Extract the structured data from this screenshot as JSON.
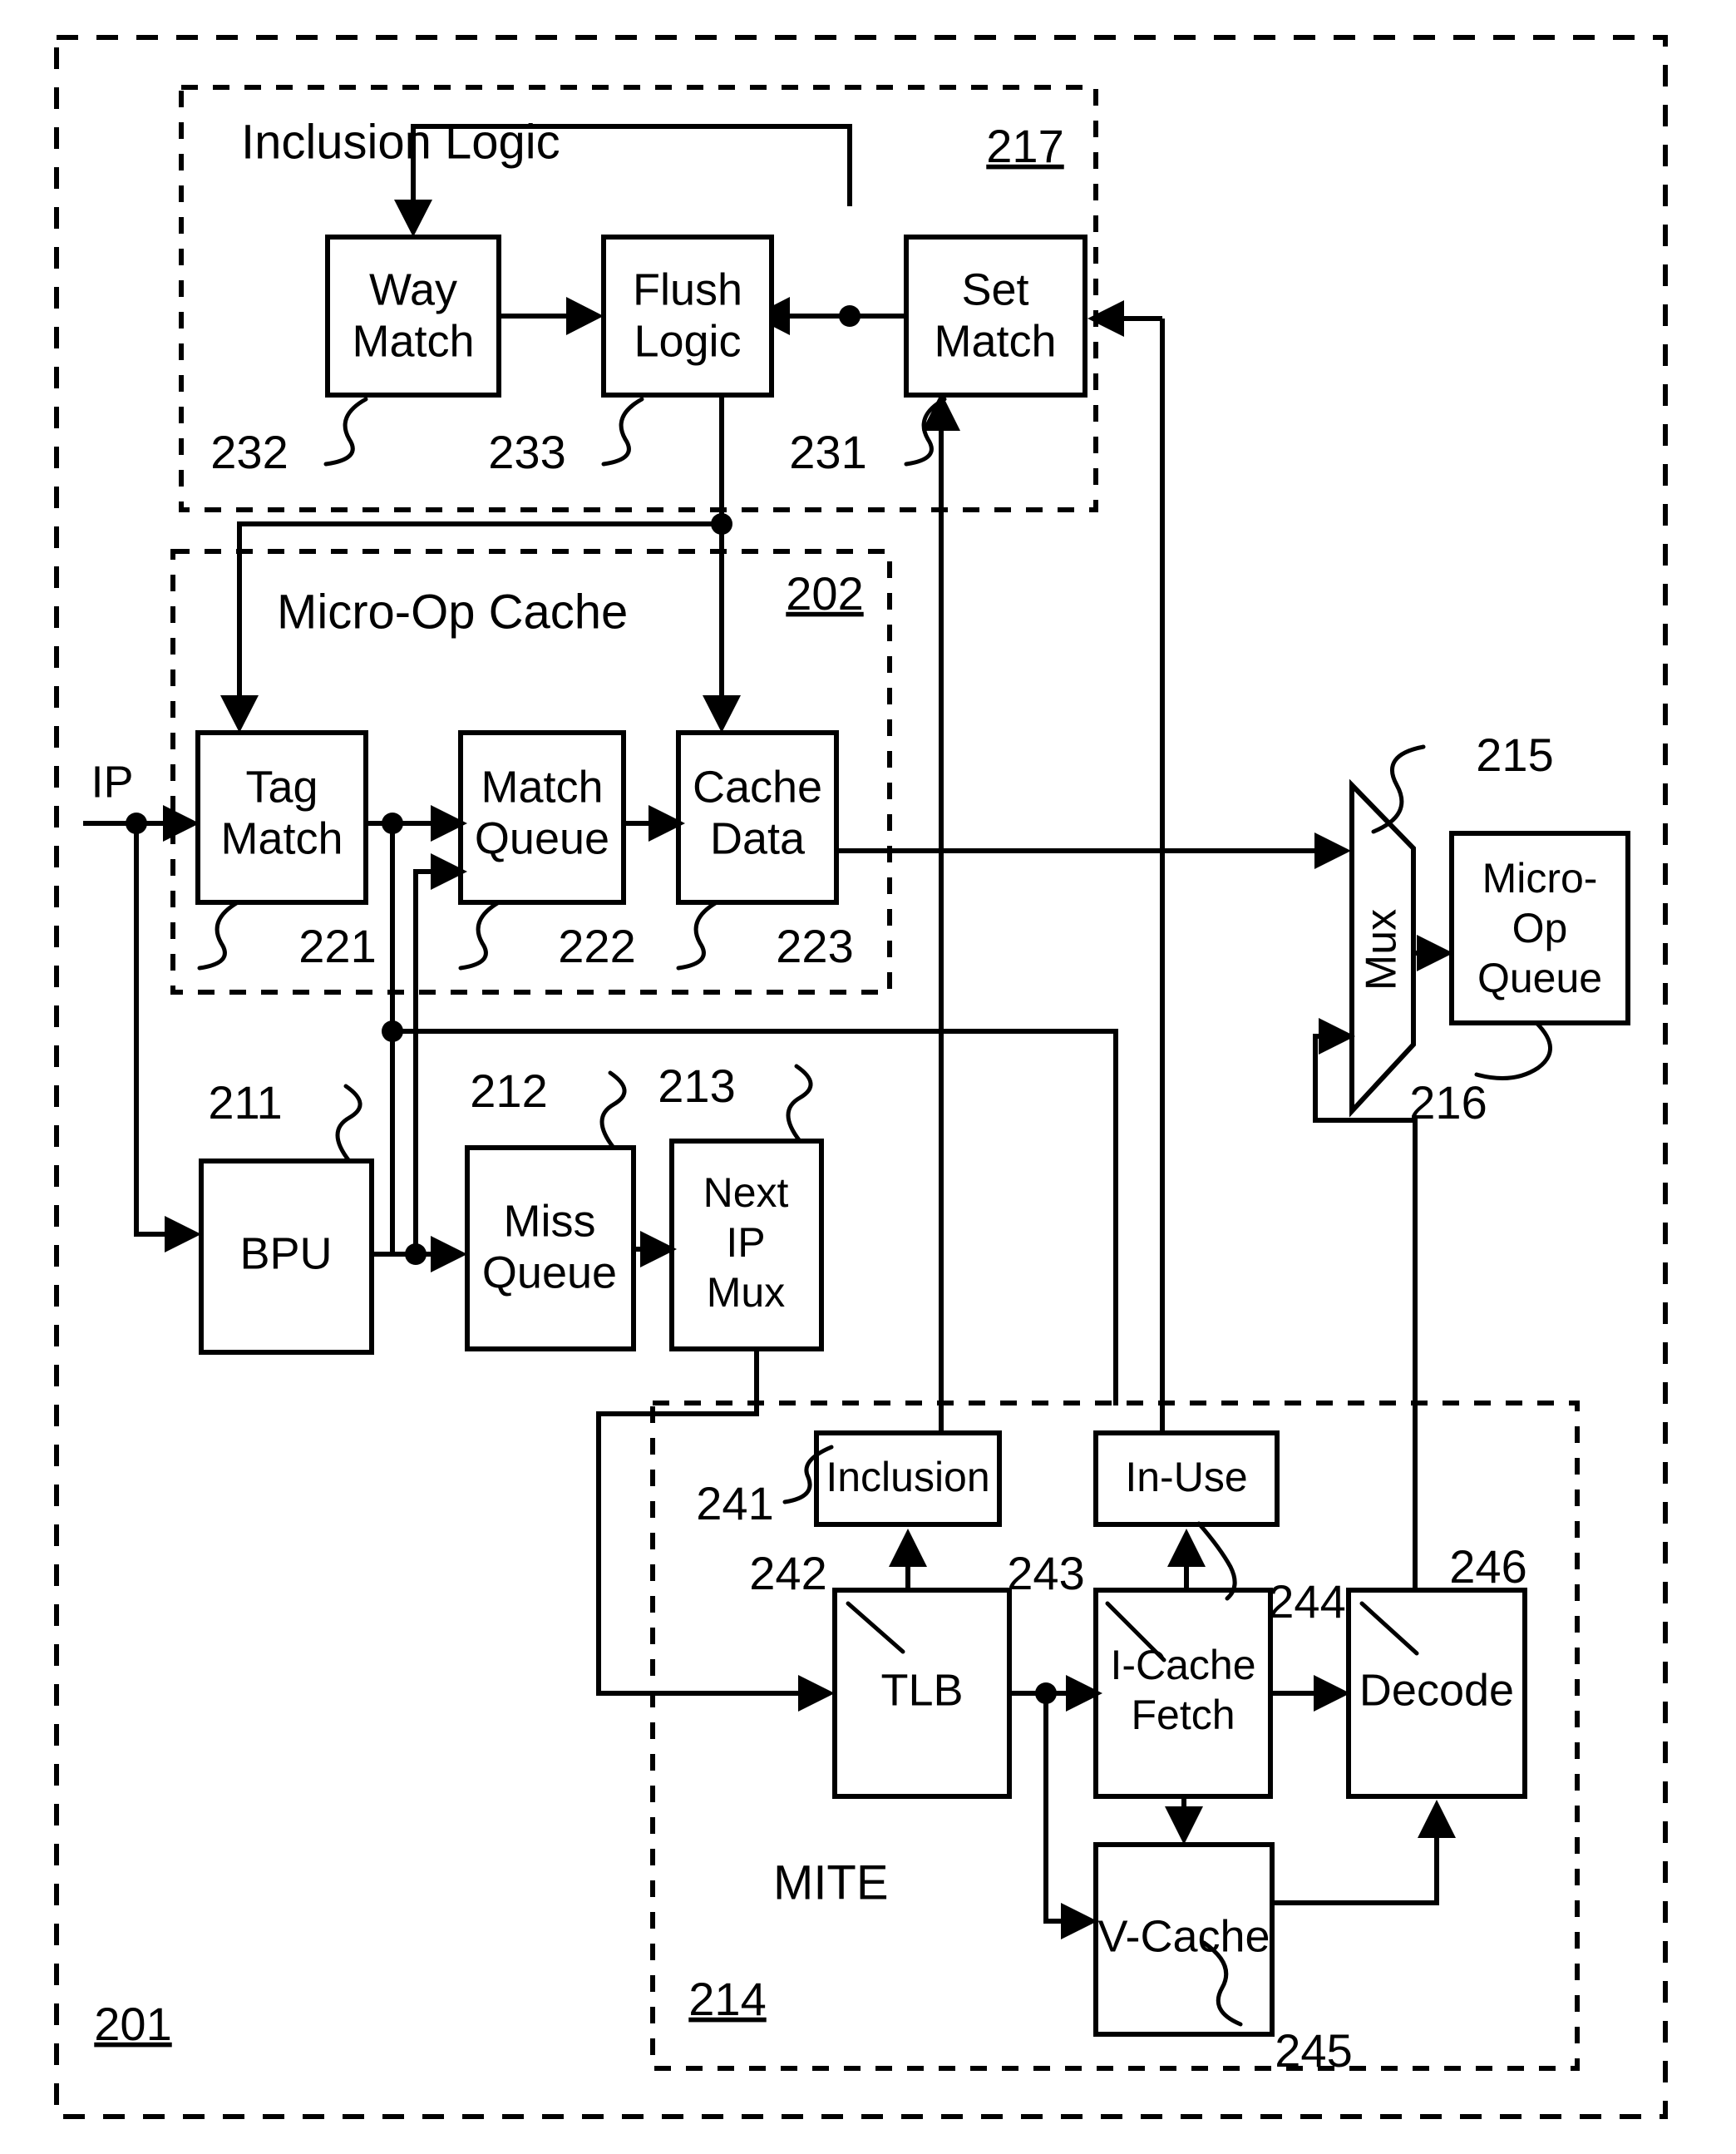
{
  "figure": {
    "type": "patent-block-diagram",
    "outer_ref": "201",
    "signal_input_label": "IP"
  },
  "groups": {
    "inclusion_logic": {
      "title": "Inclusion Logic",
      "ref": "217"
    },
    "micro_op_cache": {
      "title": "Micro-Op Cache",
      "ref": "202"
    },
    "mite": {
      "title": "MITE",
      "ref": "214"
    }
  },
  "blocks": {
    "way_match": {
      "label_line1": "Way",
      "label_line2": "Match",
      "ref": "232"
    },
    "flush_logic": {
      "label_line1": "Flush",
      "label_line2": "Logic",
      "ref": "233"
    },
    "set_match": {
      "label_line1": "Set",
      "label_line2": "Match",
      "ref": "231"
    },
    "tag_match": {
      "label_line1": "Tag",
      "label_line2": "Match",
      "ref": "221"
    },
    "match_queue": {
      "label_line1": "Match",
      "label_line2": "Queue",
      "ref": "222"
    },
    "cache_data": {
      "label_line1": "Cache",
      "label_line2": "Data",
      "ref": "223"
    },
    "bpu": {
      "label_line1": "BPU",
      "ref": "211"
    },
    "miss_queue": {
      "label_line1": "Miss",
      "label_line2": "Queue",
      "ref": "212"
    },
    "next_ip_mux": {
      "label_line1": "Next",
      "label_line2": "IP",
      "label_line3": "Mux",
      "ref": "213"
    },
    "mux": {
      "label": "Mux",
      "ref": "215"
    },
    "micro_op_queue": {
      "label_line1": "Micro-",
      "label_line2": "Op",
      "label_line3": "Queue",
      "ref": "216"
    },
    "inclusion": {
      "label": "Inclusion",
      "ref": "241"
    },
    "in_use": {
      "label": "In-Use",
      "ref": "244"
    },
    "tlb": {
      "label": "TLB",
      "ref": "242"
    },
    "icache_fetch": {
      "label_line1": "I-Cache",
      "label_line2": "Fetch",
      "ref": "243"
    },
    "decode": {
      "label": "Decode",
      "ref": "246"
    },
    "v_cache": {
      "label": "V-Cache",
      "ref": "245"
    }
  },
  "colors": {
    "ink": "#000000",
    "paper": "#ffffff"
  }
}
